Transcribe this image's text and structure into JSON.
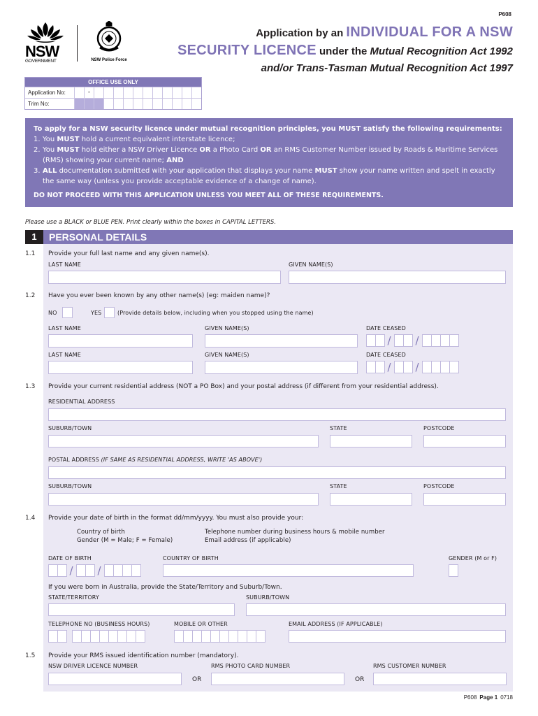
{
  "form_code": "P608",
  "logos": {
    "nsw": {
      "wordmark": "NSW",
      "subtitle": "GOVERNMENT",
      "icon": "waratah-icon"
    },
    "police": {
      "label": "NSW Police Force",
      "icon": "police-crest-icon"
    }
  },
  "title": {
    "line1_prefix": "Application by an ",
    "line1_emphasis": "INDIVIDUAL FOR A NSW",
    "line2_emphasis": "SECURITY LICENCE",
    "line2_middle": " under the ",
    "line2_italic": "Mutual Recognition Act 1992",
    "line3_italic": "and/or Trans-Tasman Mutual Recognition Act 1997"
  },
  "office_use": {
    "heading": "OFFICE USE ONLY",
    "rows": [
      {
        "label": "Application No:",
        "cells": [
          "",
          "-",
          "",
          "",
          "",
          "",
          "",
          "",
          "",
          "",
          "",
          "",
          ""
        ]
      },
      {
        "label": "Trim No:",
        "cells": [
          "",
          "",
          "",
          "",
          "",
          "",
          "",
          "",
          "",
          "",
          "",
          "",
          ""
        ]
      }
    ]
  },
  "requirements": {
    "intro": "To apply for a NSW security licence under mutual recognition principles, you MUST satisfy the following requirements:",
    "items": [
      {
        "num": "1.",
        "parts": [
          {
            "t": "You "
          },
          {
            "b": "MUST"
          },
          {
            "t": " hold a current equivalent interstate licence;"
          }
        ]
      },
      {
        "num": "2.",
        "parts": [
          {
            "t": "You "
          },
          {
            "b": "MUST"
          },
          {
            "t": " hold either a NSW Driver Licence "
          },
          {
            "b": "OR"
          },
          {
            "t": " a Photo Card "
          },
          {
            "b": "OR"
          },
          {
            "t": " an RMS Customer Number issued by Roads & Maritime Services (RMS) showing your current name; "
          },
          {
            "b": "AND"
          }
        ]
      },
      {
        "num": "3.",
        "parts": [
          {
            "b": "ALL"
          },
          {
            "t": " documentation submitted with your application that displays your name "
          },
          {
            "b": "MUST"
          },
          {
            "t": " show your name written and spelt in exactly the same way (unless you provide acceptable evidence of a change of name)."
          }
        ]
      }
    ],
    "warning": "DO NOT PROCEED WITH THIS APPLICATION UNLESS YOU MEET ALL OF THESE REQUIREMENTS."
  },
  "pen_note": "Please use a BLACK or BLUE PEN. Print clearly within the boxes in CAPITAL LETTERS.",
  "section": {
    "number": "1",
    "title": "PERSONAL DETAILS"
  },
  "q1_1": {
    "num": "1.1",
    "text": "Provide your full last name and any given name(s).",
    "last_name": "LAST NAME",
    "given_names": "GIVEN NAME(S)"
  },
  "q1_2": {
    "num": "1.2",
    "text": "Have you ever been known by any other name(s) (eg: maiden name)?",
    "no": "NO",
    "yes": "YES",
    "yes_note": "(Provide details below, including when you stopped using the name)",
    "last_name": "LAST NAME",
    "given_names": "GIVEN NAME(S)",
    "date_ceased": "DATE CEASED"
  },
  "q1_3": {
    "num": "1.3",
    "text": "Provide your current residential address (NOT a PO Box) and your postal address (if different from your residential address).",
    "residential": "RESIDENTIAL ADDRESS",
    "suburb": "SUBURB/TOWN",
    "state": "STATE",
    "postcode": "POSTCODE",
    "postal": "POSTAL ADDRESS ",
    "postal_note": "(IF SAME AS RESIDENTIAL ADDRESS, WRITE 'AS ABOVE')"
  },
  "q1_4": {
    "num": "1.4",
    "text": "Provide your date of birth in the format dd/mm/yyyy. You must also provide your:",
    "list_left": [
      "Country of birth",
      "Gender (M = Male;  F = Female)"
    ],
    "list_right": [
      "Telephone number during business hours & mobile number",
      "Email address (if applicable)"
    ],
    "dob": "DATE OF BIRTH",
    "country": "COUNTRY OF BIRTH",
    "gender": "GENDER (M or F)",
    "born_au": "If you were born in Australia, provide the State/Territory and Suburb/Town.",
    "state_territory": "STATE/TERRITORY",
    "suburb": "SUBURB/TOWN",
    "telephone": "TELEPHONE NO (BUSINESS HOURS)",
    "mobile": "MOBILE OR OTHER",
    "email": "EMAIL ADDRESS (IF APPLICABLE)"
  },
  "q1_5": {
    "num": "1.5",
    "text": "Provide your RMS issued identification number (mandatory).",
    "licence": "NSW DRIVER LICENCE NUMBER",
    "photo_card": "RMS PHOTO CARD NUMBER",
    "customer": "RMS CUSTOMER NUMBER",
    "or": "OR"
  },
  "footer": {
    "code": "P608",
    "page": "Page 1",
    "version": "0718"
  }
}
